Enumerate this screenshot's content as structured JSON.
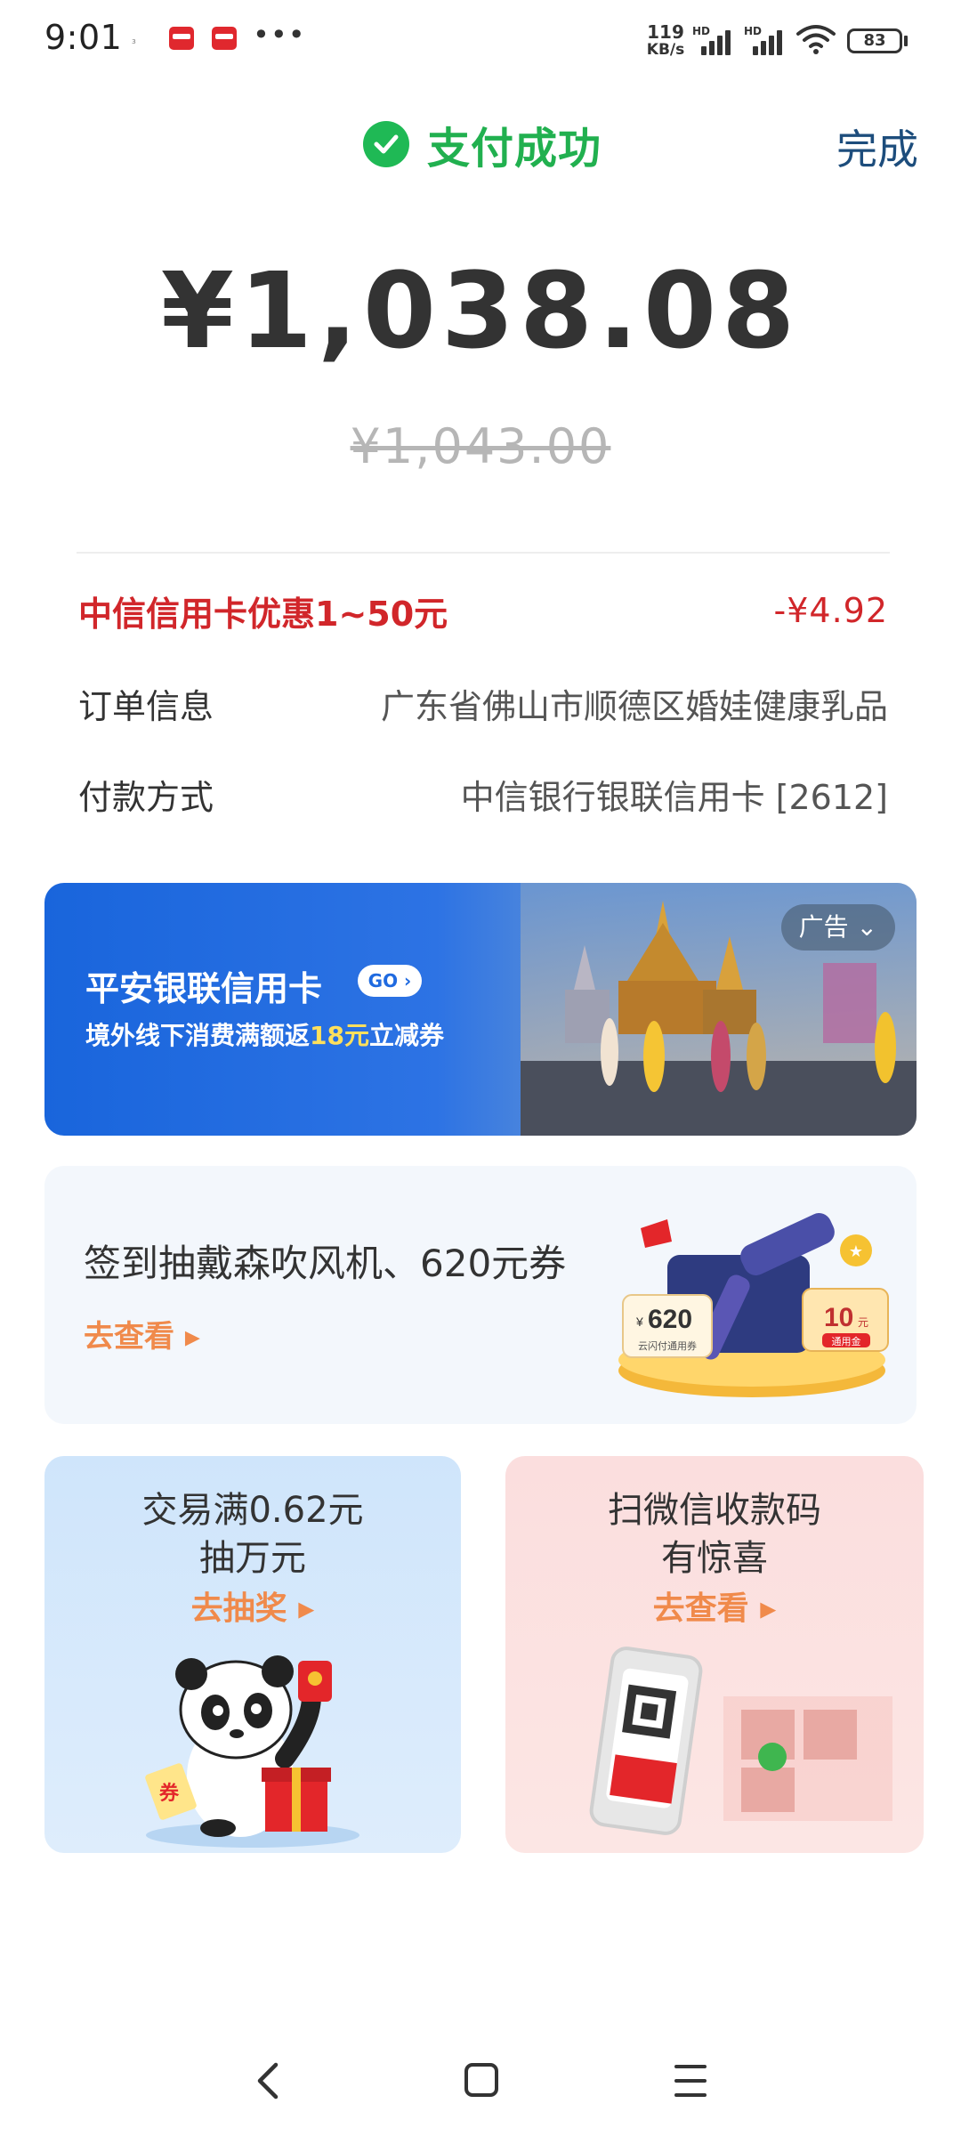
{
  "status_bar": {
    "time": "9:01",
    "small_mark": "₃",
    "dots": "•••",
    "net_speed_value": "119",
    "net_speed_unit": "KB/s",
    "signal_1_label": "HD",
    "signal_2_label": "HD",
    "battery": "83",
    "icons": [
      "app-notification-icon",
      "app-notification-icon",
      "signal-icon",
      "wifi-icon",
      "battery-icon"
    ]
  },
  "header": {
    "status_text": "支付成功",
    "done_label": "完成",
    "status_icon": "check-circle-icon",
    "accent_color": "#21b04f"
  },
  "payment": {
    "amount": "¥1,038.08",
    "original_amount": "¥1,043.00"
  },
  "details": {
    "discount_label": "中信信用卡优惠1~50元",
    "discount_amount": "-¥4.92",
    "order_label": "订单信息",
    "order_value": "广东省佛山市顺德区婚娃健康乳品",
    "method_label": "付款方式",
    "method_value": "中信银行银联信用卡 [2612]"
  },
  "banner_ad": {
    "title": "平安银联信用卡",
    "go_label": "GO",
    "subtitle_prefix": "境外线下消费满额返",
    "subtitle_highlight": "18元",
    "subtitle_suffix": "立减券",
    "ad_tag": "广告"
  },
  "signin_card": {
    "title": "签到抽戴森吹风机、620元券",
    "link": "去查看",
    "coupon_amount": "620",
    "coupon_currency": "¥",
    "coupon_caption": "云闪付通用券",
    "gold_amount": "10",
    "gold_unit": "元",
    "gold_caption": "通用金"
  },
  "promo_cards": {
    "left_line_1": "交易满0.62元",
    "left_line_2": "抽万元",
    "left_link": "去抽奖",
    "left_coupon_text": "券",
    "right_line_1": "扫微信收款码",
    "right_line_2": "有惊喜",
    "right_link": "去查看"
  },
  "nav": {
    "icons": [
      "back-icon",
      "home-icon",
      "menu-icon"
    ]
  }
}
